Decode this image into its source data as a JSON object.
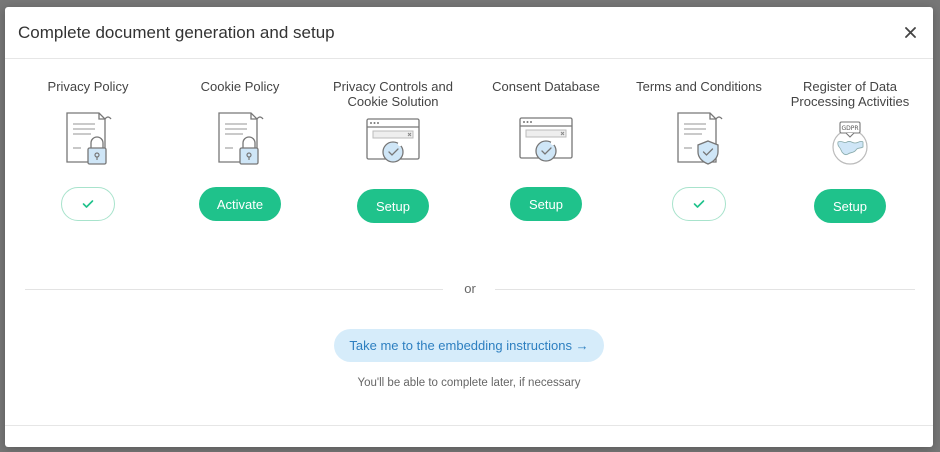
{
  "modal": {
    "title": "Complete document generation and setup",
    "close_icon": "close-icon"
  },
  "steps": [
    {
      "label": "Privacy Policy",
      "icon": "document-lock-icon",
      "action": "done",
      "action_label": ""
    },
    {
      "label": "Cookie Policy",
      "icon": "document-lock-icon",
      "action": "button",
      "action_label": "Activate"
    },
    {
      "label": "Privacy Controls and Cookie Solution",
      "icon": "browser-cookie-icon",
      "action": "button",
      "action_label": "Setup"
    },
    {
      "label": "Consent Database",
      "icon": "browser-cookie-icon",
      "action": "button",
      "action_label": "Setup"
    },
    {
      "label": "Terms and Conditions",
      "icon": "document-shield-icon",
      "action": "done",
      "action_label": ""
    },
    {
      "label": "Register of Data Processing Activities",
      "icon": "gdpr-globe-icon",
      "action": "button",
      "action_label": "Setup"
    }
  ],
  "divider": {
    "text": "or"
  },
  "embed": {
    "label": "Take me to the embedding instructions →",
    "note": "You'll be able to complete later, if necessary"
  },
  "colors": {
    "primary_green": "#1fc28b",
    "done_border": "#a8e3cc",
    "embed_bg": "#d6ecfa",
    "embed_text": "#2d7fc0",
    "icon_blue": "#cfe6f7"
  }
}
